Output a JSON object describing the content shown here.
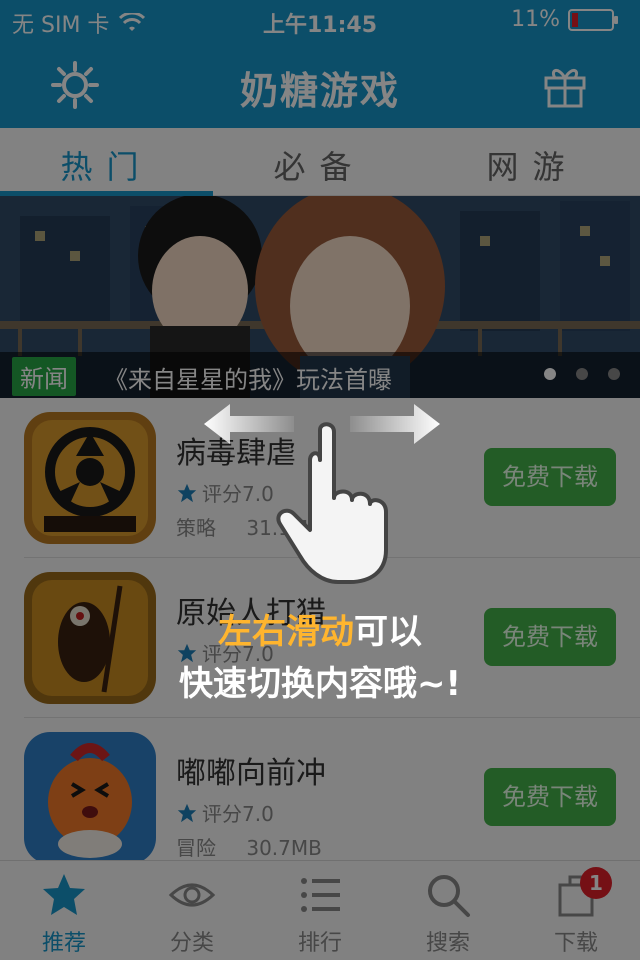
{
  "status_bar": {
    "carrier": "无 SIM 卡",
    "time": "上午11:45",
    "battery": "11%"
  },
  "header": {
    "title": "奶糖游戏",
    "left_icon": "settings-gear-icon",
    "right_icon": "gift-icon"
  },
  "tabs": [
    {
      "label": "热门",
      "active": true
    },
    {
      "label": "必备",
      "active": false
    },
    {
      "label": "网游",
      "active": false
    }
  ],
  "banner": {
    "tag": "新闻",
    "caption": "《来自星星的我》玩法首曝",
    "pages": 4,
    "current_page": 1
  },
  "apps": [
    {
      "name": "病毒肆虐",
      "rating": "评分7.0",
      "category": "策略",
      "size": "31.1MB",
      "button": "免费下载"
    },
    {
      "name": "原始人打猎",
      "rating": "评分7.0",
      "category": "",
      "size": "",
      "button": "免费下载"
    },
    {
      "name": "嘟嘟向前冲",
      "rating": "评分7.0",
      "category": "冒险",
      "size": "30.7MB",
      "button": "免费下载"
    }
  ],
  "tabbar": [
    {
      "label": "推荐",
      "icon": "star-icon",
      "active": true
    },
    {
      "label": "分类",
      "icon": "eye-icon",
      "active": false
    },
    {
      "label": "排行",
      "icon": "list-icon",
      "active": false
    },
    {
      "label": "搜索",
      "icon": "search-icon",
      "active": false
    },
    {
      "label": "下载",
      "icon": "download-icon",
      "active": false,
      "badge": "1"
    }
  ],
  "guide": {
    "highlight": "左右滑动",
    "line1_rest": "可以",
    "line2": "快速切换内容哦~!"
  },
  "colors": {
    "primary": "#1796c9",
    "button_green": "#43b04a",
    "highlight": "#ffb52e",
    "badge_red": "#e0202a"
  }
}
